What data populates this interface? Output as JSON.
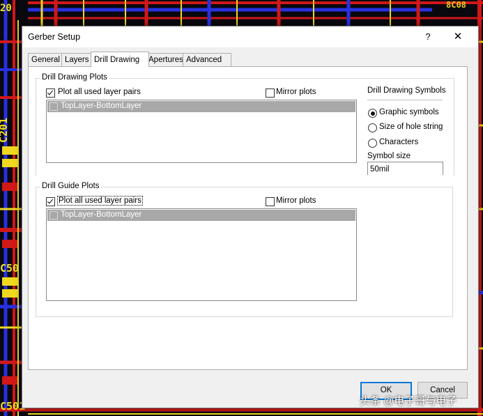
{
  "background": {
    "labels": {
      "top_left": "20",
      "top_right": "8C08",
      "c201": "C201",
      "c50": "C50",
      "c501": "C501"
    },
    "colors": {
      "trace_red": "#d01818",
      "trace_blue": "#2830e0",
      "trace_yellow": "#f0d820",
      "board": "#08080e"
    }
  },
  "dialog": {
    "title": "Gerber Setup",
    "help_label": "?",
    "close_label": "✕",
    "tabs": [
      {
        "label": "General"
      },
      {
        "label": "Layers"
      },
      {
        "label": "Drill Drawing"
      },
      {
        "label": "Apertures"
      },
      {
        "label": "Advanced"
      }
    ],
    "drill_drawing_plots": {
      "title": "Drill Drawing Plots",
      "plot_all_label": "Plot all used layer pairs",
      "plot_all_checked": true,
      "mirror_label": "Mirror plots",
      "mirror_checked": false,
      "layer_pairs": [
        {
          "label": "TopLayer-BottomLayer",
          "checked": false
        }
      ]
    },
    "drill_drawing_symbols": {
      "title": "Drill Drawing Symbols",
      "options": [
        {
          "label": "Graphic symbols",
          "selected": true
        },
        {
          "label": "Size of hole string",
          "selected": false
        },
        {
          "label": "Characters",
          "selected": false
        }
      ],
      "symbol_size_label": "Symbol size",
      "symbol_size_value": "50mil"
    },
    "drill_guide_plots": {
      "title": "Drill Guide Plots",
      "plot_all_label": "Plot all used layer pairs",
      "plot_all_checked": true,
      "mirror_label": "Mirror plots",
      "mirror_checked": false,
      "layer_pairs": [
        {
          "label": "TopLayer-BottomLayer",
          "checked": false
        }
      ]
    },
    "buttons": {
      "ok": "OK",
      "cancel": "Cancel"
    },
    "accent_color": "#0078d7"
  },
  "watermark": "头条 @电子哥与电子"
}
